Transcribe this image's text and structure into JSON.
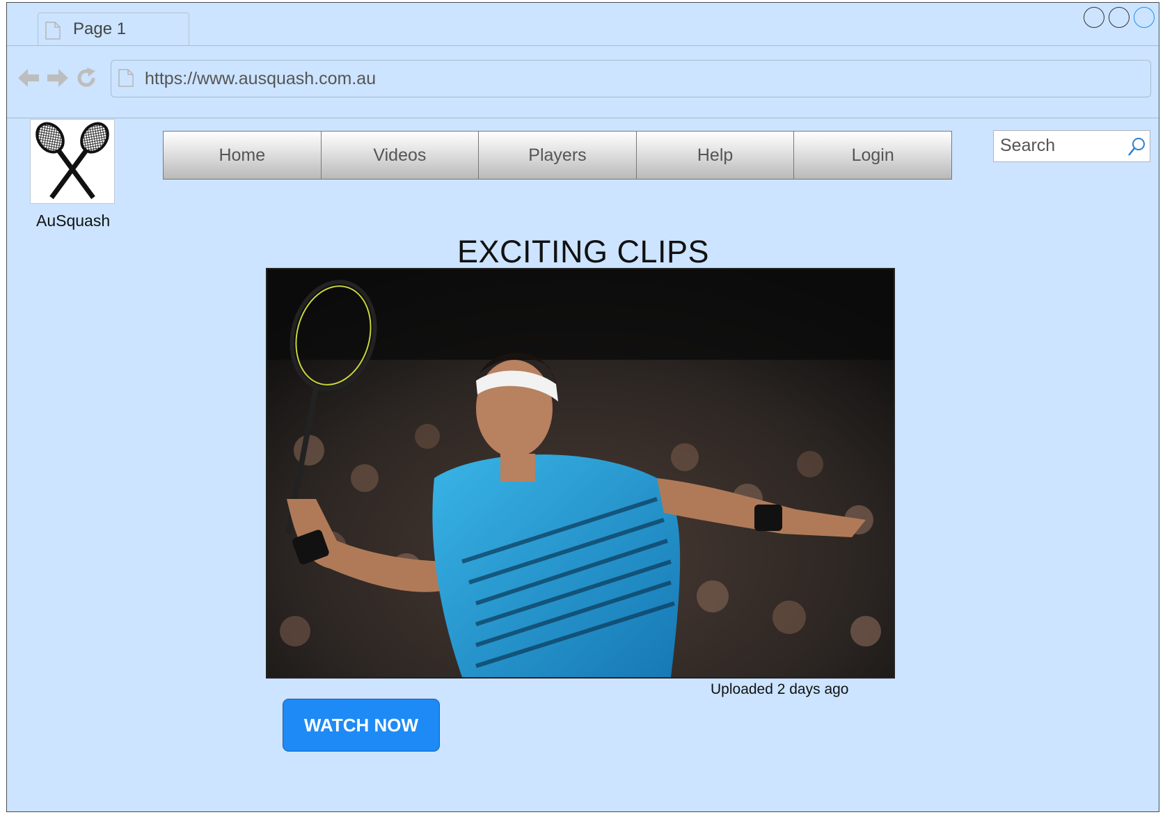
{
  "browser": {
    "tab_title": "Page 1",
    "url": "https://www.ausquash.com.au",
    "window_controls": [
      "minimize",
      "maximize",
      "close"
    ]
  },
  "site": {
    "logo_label": "AuSquash",
    "logo_icon": "crossed-rackets-icon"
  },
  "nav": {
    "items": [
      {
        "label": "Home"
      },
      {
        "label": "Videos"
      },
      {
        "label": "Players"
      },
      {
        "label": "Help"
      },
      {
        "label": "Login"
      }
    ]
  },
  "search": {
    "placeholder": "Search"
  },
  "main": {
    "title": "EXCITING CLIPS",
    "hero_image": "squash-player-photo",
    "upload_text": "Uploaded 2 days ago",
    "cta_label": "WATCH NOW"
  },
  "colors": {
    "page_bg": "#cce4ff",
    "accent": "#1e8af5"
  }
}
